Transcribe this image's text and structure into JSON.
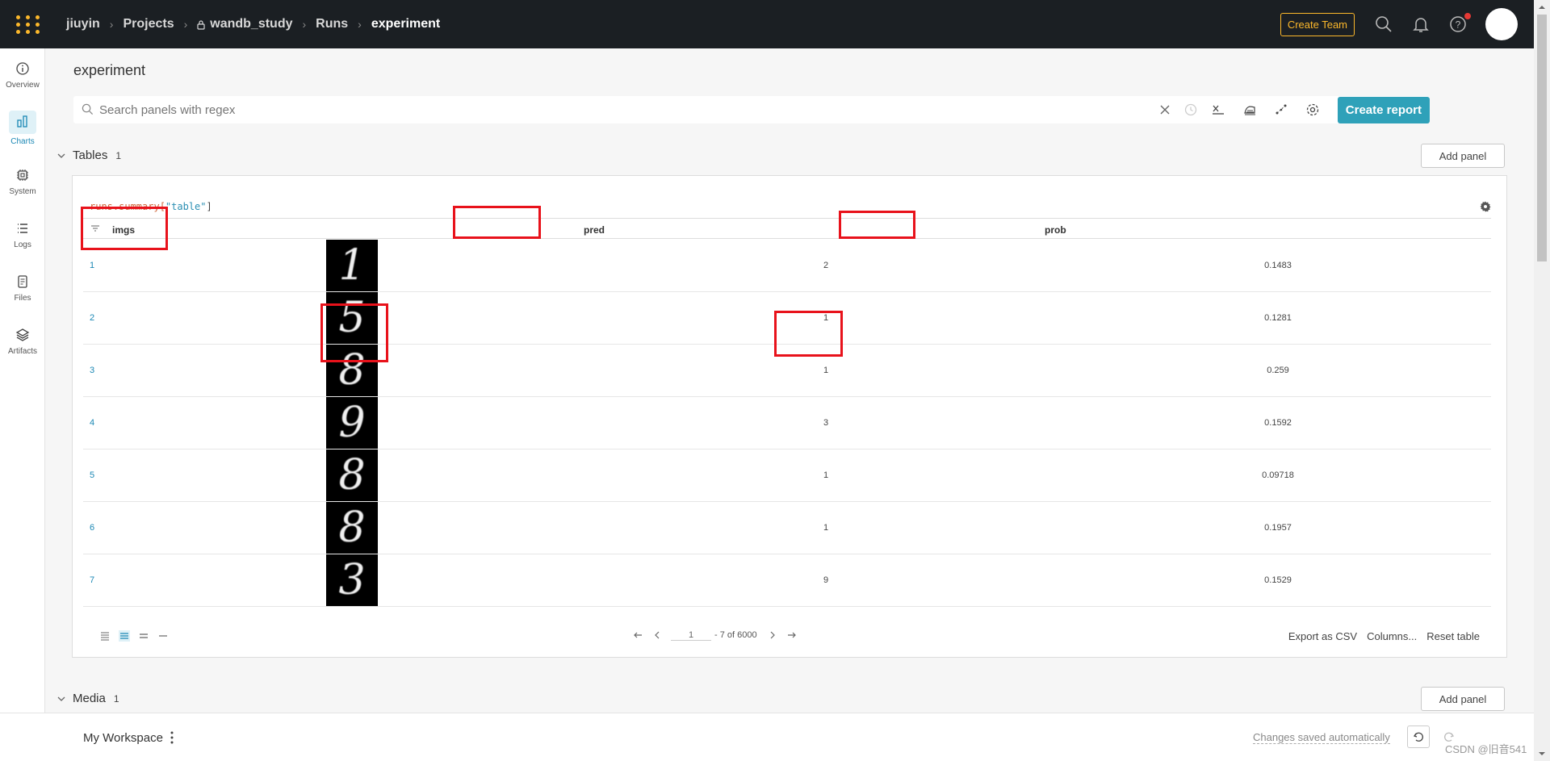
{
  "topbar": {
    "breadcrumb": [
      "jiuyin",
      "Projects",
      "wandb_study",
      "Runs",
      "experiment"
    ],
    "create_team": "Create Team"
  },
  "leftnav": {
    "items": [
      {
        "label": "Overview",
        "icon": "info-icon"
      },
      {
        "label": "Charts",
        "icon": "bar-chart-icon",
        "active": true
      },
      {
        "label": "System",
        "icon": "cpu-icon"
      },
      {
        "label": "Logs",
        "icon": "list-icon"
      },
      {
        "label": "Files",
        "icon": "file-icon"
      },
      {
        "label": "Artifacts",
        "icon": "layers-icon"
      }
    ]
  },
  "main": {
    "title": "experiment",
    "search_placeholder": "Search panels with regex",
    "create_report": "Create report"
  },
  "sections": {
    "tables": {
      "title": "Tables",
      "count": "1",
      "add_panel": "Add panel"
    },
    "media": {
      "title": "Media",
      "count": "1",
      "add_panel": "Add panel"
    }
  },
  "table_panel": {
    "query_prefix": "runs.summary[",
    "query_key": "\"table\"",
    "query_suffix": "]",
    "columns": [
      "imgs",
      "pred",
      "prob"
    ],
    "rows": [
      {
        "index": "1",
        "img_digit": "1",
        "pred": "2",
        "prob": "0.1483"
      },
      {
        "index": "2",
        "img_digit": "5",
        "pred": "1",
        "prob": "0.1281"
      },
      {
        "index": "3",
        "img_digit": "8",
        "pred": "1",
        "prob": "0.259"
      },
      {
        "index": "4",
        "img_digit": "9",
        "pred": "3",
        "prob": "0.1592"
      },
      {
        "index": "5",
        "img_digit": "8",
        "pred": "1",
        "prob": "0.09718"
      },
      {
        "index": "6",
        "img_digit": "8",
        "pred": "1",
        "prob": "0.1957"
      },
      {
        "index": "7",
        "img_digit": "3",
        "pred": "9",
        "prob": "0.1529"
      }
    ],
    "pager": {
      "page": "1",
      "range": "- 7 of 6000"
    },
    "footer_actions": [
      "Export as CSV",
      "Columns...",
      "Reset table"
    ]
  },
  "bottombar": {
    "workspace": "My Workspace",
    "saved": "Changes saved automatically",
    "watermark": "CSDN @旧音541"
  },
  "colors": {
    "accent": "#2fa1b9",
    "brand": "#fcb82b",
    "highlight_box": "#e8121b"
  }
}
